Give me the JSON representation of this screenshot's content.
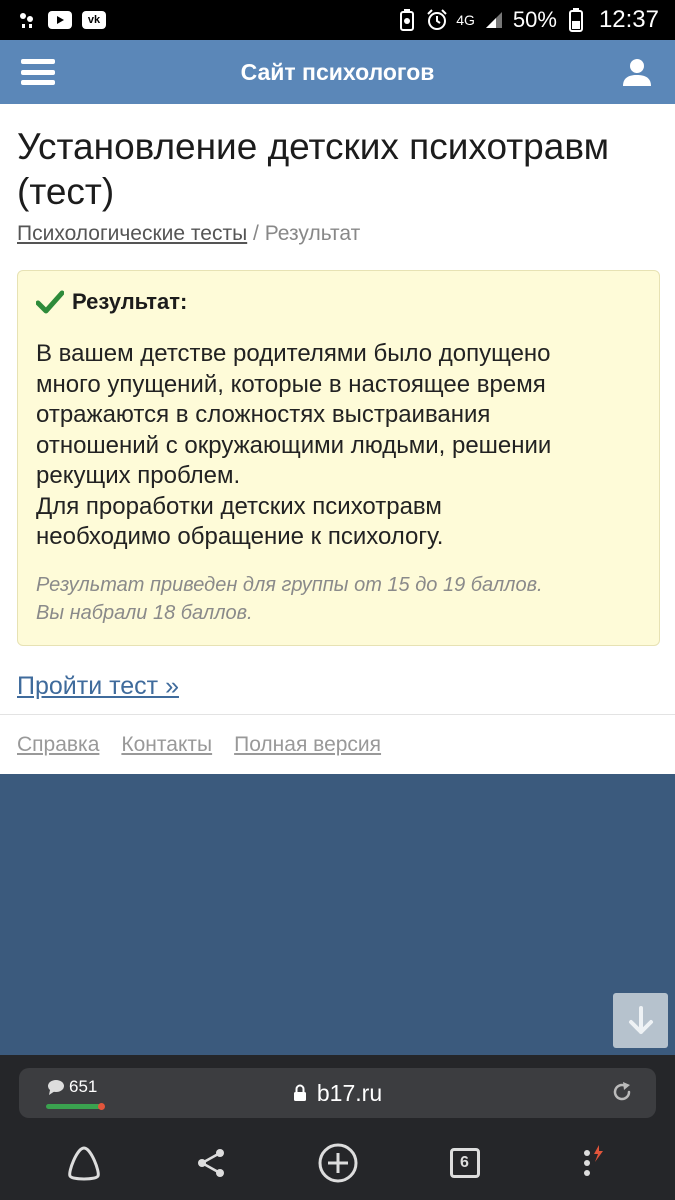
{
  "statusbar": {
    "network": "4G",
    "battery": "50%",
    "time": "12:37"
  },
  "header": {
    "title": "Сайт психологов"
  },
  "page": {
    "title": "Установление детских психотравм (тест)",
    "breadcrumb": {
      "link": "Психологические тесты",
      "separator": " / ",
      "current": "Результат"
    }
  },
  "result": {
    "heading": "Результат:",
    "text_lines": [
      "В вашем детстве родителями было допущено",
      "много упущений, которые в настоящее время",
      "отражаются в сложностях выстраивания",
      "отношений с окружающими людьми, решении",
      "рекущих проблем.",
      "Для проработки детских психотравм",
      "необходимо обращение к психологу."
    ],
    "note_lines": [
      "Результат приведен для группы от 15 до 19 баллов.",
      "Вы набрали 18 баллов."
    ]
  },
  "take_test_link": "Пройти тест »",
  "footer": {
    "links": [
      "Справка",
      "Контакты",
      "Полная версия"
    ]
  },
  "browser": {
    "comments_count": "651",
    "url": "b17.ru",
    "tabs_count": "6"
  },
  "colors": {
    "header_bg": "#5b87b8",
    "result_bg": "#fefbd8",
    "check_green": "#2e8b3a",
    "link_blue": "#3f6b9c",
    "page_bg": "#3b5a7d"
  }
}
